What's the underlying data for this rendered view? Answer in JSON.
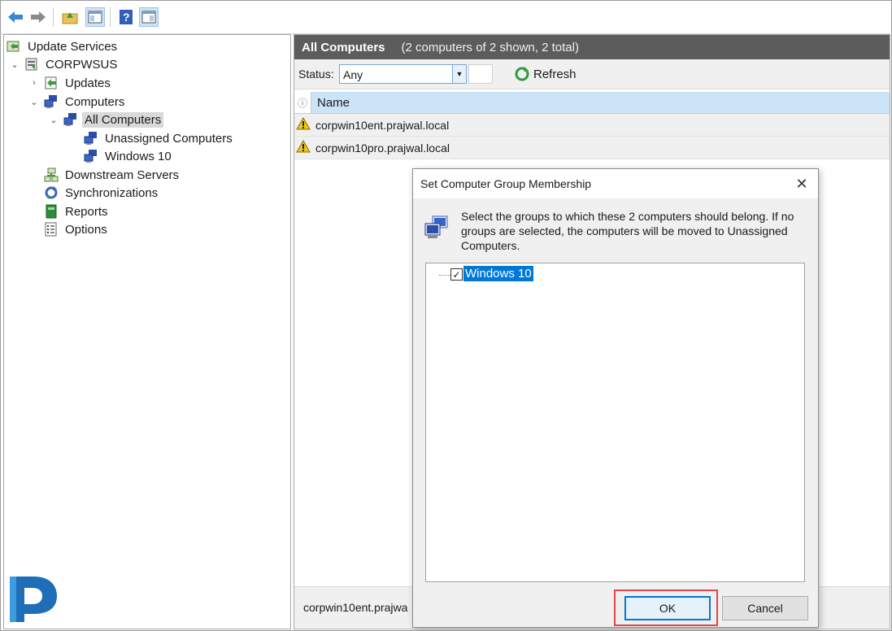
{
  "tree": {
    "root": "Update Services",
    "server": "CORPWSUS",
    "updates": "Updates",
    "computers": "Computers",
    "all_computers": "All Computers",
    "unassigned": "Unassigned Computers",
    "windows10": "Windows 10",
    "downstream": "Downstream Servers",
    "synchronizations": "Synchronizations",
    "reports": "Reports",
    "options": "Options"
  },
  "panel": {
    "title": "All Computers",
    "subtitle": "(2 computers of 2 shown, 2 total)",
    "status_label": "Status:",
    "status_value": "Any",
    "refresh_label": "Refresh",
    "column_name": "Name",
    "rows": [
      "corpwin10ent.prajwal.local",
      "corpwin10pro.prajwal.local"
    ],
    "bottom_text": "corpwin10ent.prajwa"
  },
  "dialog": {
    "title": "Set Computer Group Membership",
    "message": "Select the groups to which these 2 computers should belong. If no groups are selected, the computers will be moved to Unassigned Computers.",
    "group_label": "Windows 10",
    "group_checked": true,
    "ok_label": "OK",
    "cancel_label": "Cancel"
  },
  "colors": {
    "selection": "#0078d7",
    "header": "#5c5c5c",
    "highlight": "#e0474c"
  }
}
